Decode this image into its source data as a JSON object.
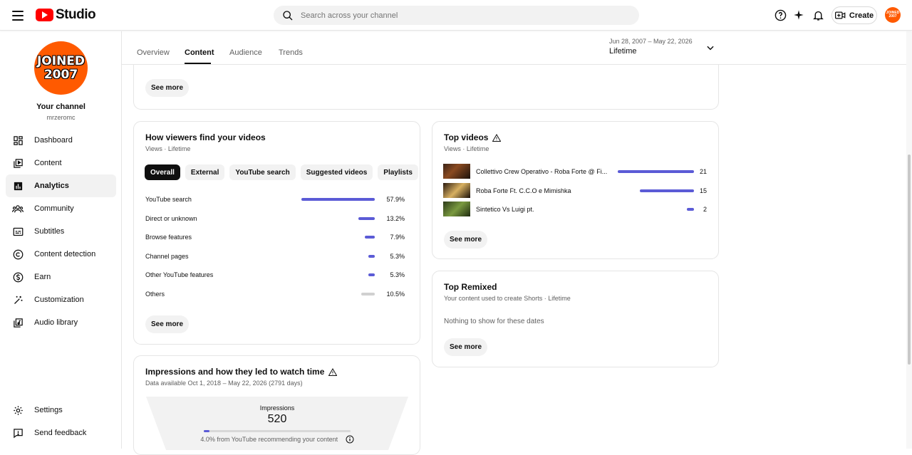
{
  "header": {
    "logo_text": "Studio",
    "search_placeholder": "Search across your channel",
    "create_label": "Create",
    "avatar_text": "JOINED 2007"
  },
  "sidebar": {
    "avatar_text_line1": "JOINED",
    "avatar_text_line2": "2007",
    "channel_title": "Your channel",
    "channel_handle": "mrzeromc",
    "items": [
      {
        "label": "Dashboard",
        "icon": "dashboard-icon"
      },
      {
        "label": "Content",
        "icon": "content-icon"
      },
      {
        "label": "Analytics",
        "icon": "analytics-icon",
        "active": true
      },
      {
        "label": "Community",
        "icon": "community-icon"
      },
      {
        "label": "Subtitles",
        "icon": "subtitles-icon"
      },
      {
        "label": "Content detection",
        "icon": "copyright-icon"
      },
      {
        "label": "Earn",
        "icon": "dollar-icon"
      },
      {
        "label": "Customization",
        "icon": "wand-icon"
      },
      {
        "label": "Audio library",
        "icon": "audio-library-icon"
      }
    ],
    "bottom_items": [
      {
        "label": "Settings",
        "icon": "gear-icon"
      },
      {
        "label": "Send feedback",
        "icon": "feedback-icon"
      }
    ]
  },
  "tabs": {
    "items": [
      "Overview",
      "Content",
      "Audience",
      "Trends"
    ],
    "active": "Content",
    "date_range": "Jun 28, 2007 – May 22, 2026",
    "date_label": "Lifetime"
  },
  "top_card": {
    "see_more": "See more"
  },
  "traffic_sources": {
    "title": "How viewers find your videos",
    "subtitle": "Views · Lifetime",
    "chips": [
      "Overall",
      "External",
      "YouTube search",
      "Suggested videos",
      "Playlists"
    ],
    "selected_chip": "Overall",
    "rows": [
      {
        "label": "YouTube search",
        "value": 57.9,
        "pct": "57.9%",
        "color": "#5b5bd6"
      },
      {
        "label": "Direct or unknown",
        "value": 13.2,
        "pct": "13.2%",
        "color": "#5b5bd6"
      },
      {
        "label": "Browse features",
        "value": 7.9,
        "pct": "7.9%",
        "color": "#5b5bd6"
      },
      {
        "label": "Channel pages",
        "value": 5.3,
        "pct": "5.3%",
        "color": "#5b5bd6"
      },
      {
        "label": "Other YouTube features",
        "value": 5.3,
        "pct": "5.3%",
        "color": "#5b5bd6"
      },
      {
        "label": "Others",
        "value": 10.5,
        "pct": "10.5%",
        "color": "#d0d0d0"
      }
    ],
    "see_more": "See more"
  },
  "top_videos": {
    "title": "Top videos",
    "subtitle": "Views · Lifetime",
    "rows": [
      {
        "title": "Collettivo Crew Operativo - Roba Forte @ Fi...",
        "value": 21,
        "value_text": "21"
      },
      {
        "title": "Roba Forte Ft. C.C.O e Mimishka",
        "value": 15,
        "value_text": "15"
      },
      {
        "title": "Sintetico Vs Luigi pt.",
        "value": 2,
        "value_text": "2"
      }
    ],
    "see_more": "See more"
  },
  "top_remixed": {
    "title": "Top Remixed",
    "subtitle": "Your content used to create Shorts · Lifetime",
    "empty_text": "Nothing to show for these dates",
    "see_more": "See more"
  },
  "impressions": {
    "title": "Impressions and how they led to watch time",
    "subtitle": "Data available Oct 1, 2018 – May 22, 2026 (2791 days)",
    "label": "Impressions",
    "value": "520",
    "ctr_fraction": 0.04,
    "note": "4.0% from YouTube recommending your content"
  },
  "colors": {
    "accent": "#5b5bd6",
    "avatar_bg": "#ff5a00",
    "logo_red": "#ff0000"
  }
}
